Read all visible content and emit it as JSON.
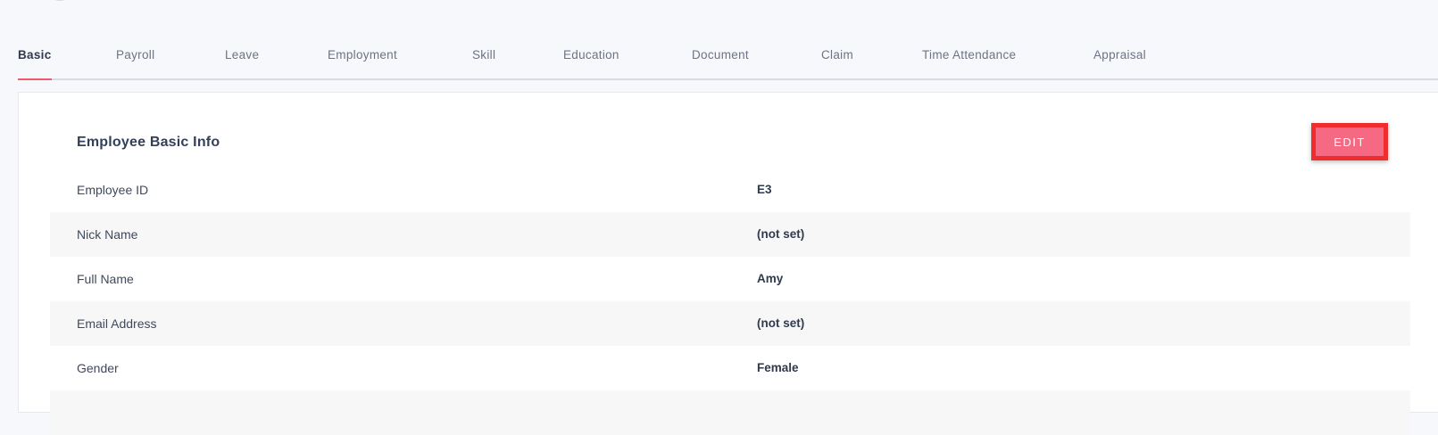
{
  "tabs": [
    {
      "label": "Basic",
      "active": true
    },
    {
      "label": "Payroll"
    },
    {
      "label": "Leave"
    },
    {
      "label": "Employment"
    },
    {
      "label": "Skill"
    },
    {
      "label": "Education"
    },
    {
      "label": "Document"
    },
    {
      "label": "Claim"
    },
    {
      "label": "Time Attendance"
    },
    {
      "label": "Appraisal"
    }
  ],
  "card": {
    "title": "Employee Basic Info",
    "edit_label": "EDIT"
  },
  "fields": [
    {
      "label": "Employee ID",
      "value": "E3"
    },
    {
      "label": "Nick Name",
      "value": "(not set)"
    },
    {
      "label": "Full Name",
      "value": "Amy"
    },
    {
      "label": "Email Address",
      "value": "(not set)"
    },
    {
      "label": "Gender",
      "value": "Female"
    },
    {
      "label": "",
      "value": ""
    }
  ],
  "colors": {
    "accent": "#f05a6d",
    "edit_button": "#f56a82",
    "highlight_frame": "#ef2d2d"
  }
}
